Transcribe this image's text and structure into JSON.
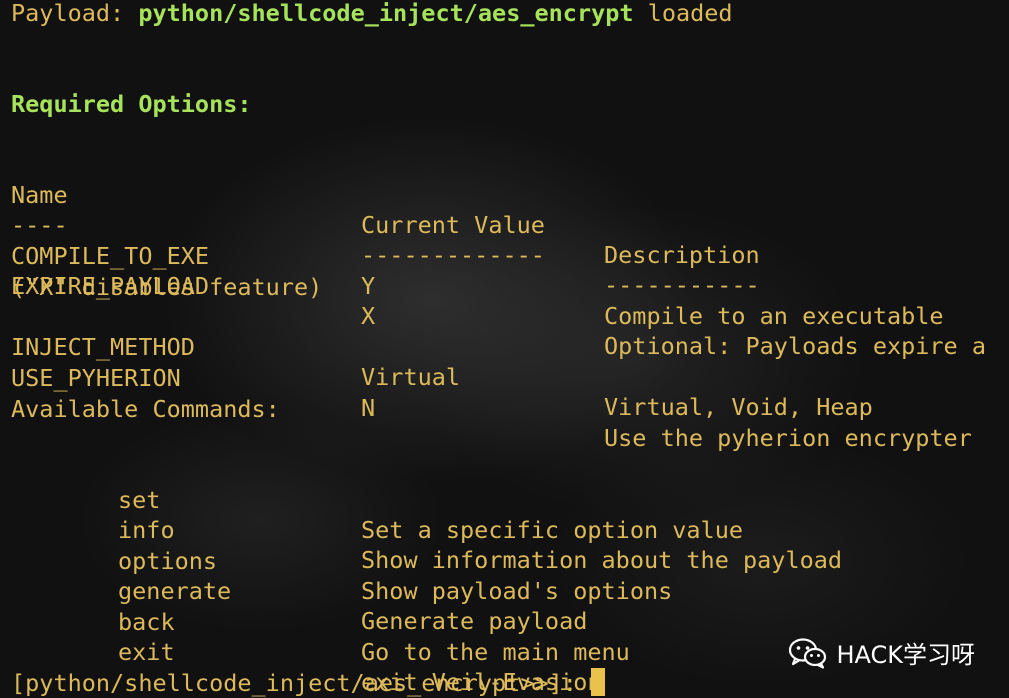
{
  "header": {
    "prefix": "Payload: ",
    "payload": "python/shellcode_inject/aes_encrypt",
    "suffix": " loaded"
  },
  "required_options": {
    "title": "Required Options:",
    "columns": [
      "Name",
      "Current Value",
      "Description"
    ],
    "separators": [
      "----",
      "-------------",
      "-----------"
    ],
    "rows": [
      {
        "name": "COMPILE_TO_EXE",
        "value": "Y",
        "description": "Compile to an executable"
      },
      {
        "name": "EXPIRE_PAYLOAD",
        "value": "X",
        "description": "Optional: Payloads expire a"
      },
      {
        "name": "INJECT_METHOD",
        "value": "Virtual",
        "description": "Virtual, Void, Heap"
      },
      {
        "name": "USE_PYHERION",
        "value": "N",
        "description": "Use the pyherion encrypter"
      }
    ],
    "wrap_line": "(\"X\" disables feature)"
  },
  "available_commands": {
    "title": "Available Commands:",
    "items": [
      {
        "cmd": "set",
        "desc": "Set a specific option value"
      },
      {
        "cmd": "info",
        "desc": "Show information about the payload"
      },
      {
        "cmd": "options",
        "desc": "Show payload's options"
      },
      {
        "cmd": "generate",
        "desc": "Generate payload"
      },
      {
        "cmd": "back",
        "desc": "Go to the main menu"
      },
      {
        "cmd": "exit",
        "desc": "exit Veil-Evasion"
      }
    ]
  },
  "prompt": "[python/shellcode_inject/aes_encrypt>>]: ",
  "watermark": {
    "icon": "wechat-icon",
    "text": "HACK学习呀"
  },
  "colors": {
    "text": "#dcb95a",
    "accent": "#a6e35a",
    "cursor": "#e8c24a"
  }
}
